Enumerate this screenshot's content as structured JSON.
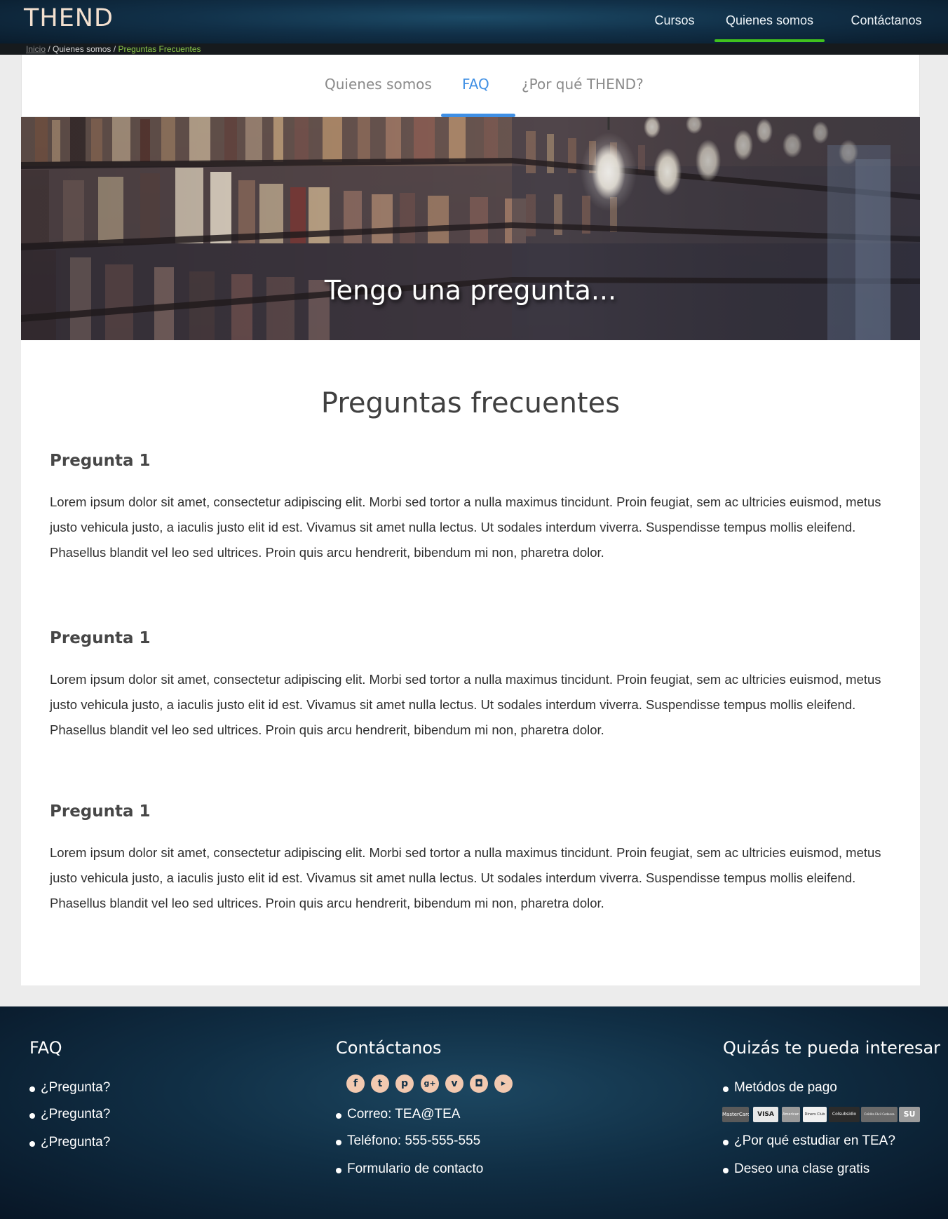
{
  "header": {
    "logo_text": "THEND",
    "nav": [
      {
        "label": "Cursos"
      },
      {
        "label": "Quienes somos",
        "active": true
      },
      {
        "label": "Contáctanos"
      }
    ],
    "active_color": "#41c21d"
  },
  "breadcrumb": {
    "home": "Inicio",
    "separator": "/",
    "middle": "Quienes somos",
    "current": "Preguntas Frecuentes"
  },
  "subtabs": {
    "items": [
      {
        "label": "Quienes somos"
      },
      {
        "label": "FAQ",
        "active": true
      },
      {
        "label": "¿Por qué THEND?"
      }
    ],
    "active_color": "#3f8fe4"
  },
  "hero": {
    "title": "Tengo una pregunta..."
  },
  "faq": {
    "title": "Preguntas frecuentes",
    "items": [
      {
        "question": "Pregunta 1",
        "answer": "Lorem ipsum dolor sit amet, consectetur adipiscing elit. Morbi sed tortor a nulla maximus tincidunt. Proin feugiat, sem ac ultricies euismod, metus justo vehicula justo, a iaculis justo elit id est. Vivamus sit amet nulla lectus. Ut sodales interdum viverra. Suspendisse tempus mollis eleifend. Phasellus blandit vel leo sed ultrices. Proin quis arcu hendrerit, bibendum mi non, pharetra dolor."
      },
      {
        "question": "Pregunta 1",
        "answer": "Lorem ipsum dolor sit amet, consectetur adipiscing elit. Morbi sed tortor a nulla maximus tincidunt. Proin feugiat, sem ac ultricies euismod, metus justo vehicula justo, a iaculis justo elit id est. Vivamus sit amet nulla lectus. Ut sodales interdum viverra. Suspendisse tempus mollis eleifend. Phasellus blandit vel leo sed ultrices. Proin quis arcu hendrerit, bibendum mi non, pharetra dolor."
      },
      {
        "question": "Pregunta 1",
        "answer": "Lorem ipsum dolor sit amet, consectetur adipiscing elit. Morbi sed tortor a nulla maximus tincidunt. Proin feugiat, sem ac ultricies euismod, metus justo vehicula justo, a iaculis justo elit id est. Vivamus sit amet nulla lectus. Ut sodales interdum viverra. Suspendisse tempus mollis eleifend. Phasellus blandit vel leo sed ultrices. Proin quis arcu hendrerit, bibendum mi non, pharetra dolor."
      }
    ]
  },
  "footer": {
    "faq": {
      "title": "FAQ",
      "items": [
        "¿Pregunta?",
        "¿Pregunta?",
        "¿Pregunta?"
      ]
    },
    "contact": {
      "title": "Contáctanos",
      "social_icons": [
        "facebook-icon",
        "twitter-icon",
        "pinterest-icon",
        "google-plus-icon",
        "vimeo-icon",
        "instagram-icon",
        "youtube-icon"
      ],
      "items": [
        "Correo: TEA@TEA",
        "Teléfono: 555-555-555",
        "Formulario de contacto"
      ]
    },
    "interest": {
      "title": "Quizás te pueda interesar",
      "items": [
        "Metódos de pago",
        "¿Por qué estudiar en TEA?",
        "Deseo una clase gratis"
      ],
      "payment_logos": [
        "MasterCard",
        "VISA",
        "American Express",
        "Diners Club",
        "Colsubsidio",
        "Crédito Fácil Codensa",
        "SU"
      ]
    }
  }
}
